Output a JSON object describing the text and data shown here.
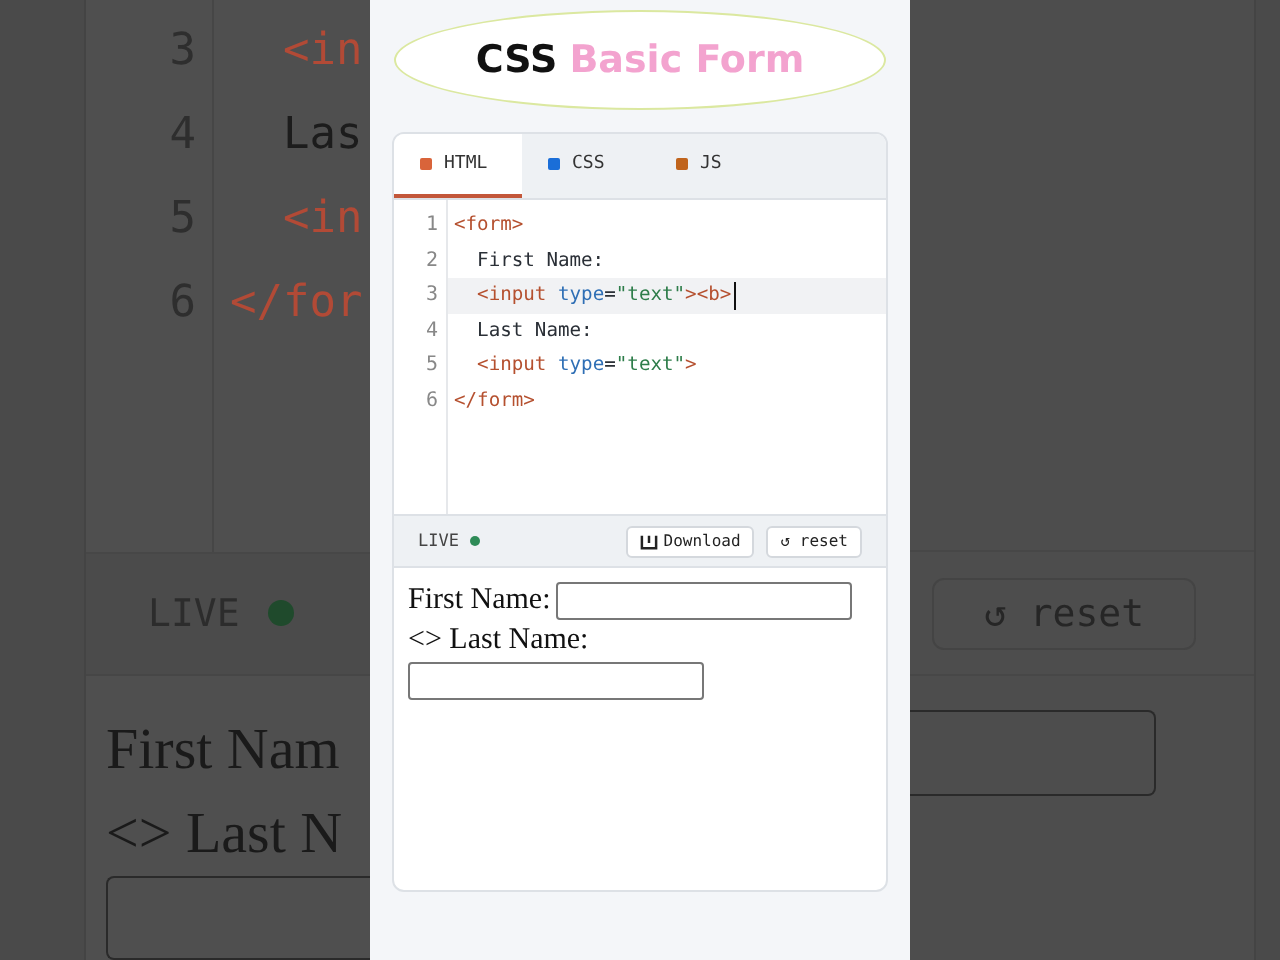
{
  "backdrop_left": {
    "code_lines": [
      {
        "number": "3",
        "tokens": [
          {
            "kind": "tag",
            "text": "  <in"
          }
        ]
      },
      {
        "number": "4",
        "tokens": [
          {
            "kind": "plain",
            "text": "  Las"
          }
        ]
      },
      {
        "number": "5",
        "tokens": [
          {
            "kind": "tag",
            "text": "  <in"
          }
        ]
      },
      {
        "number": "6",
        "tokens": [
          {
            "kind": "tag",
            "text": "</for"
          }
        ]
      }
    ],
    "live_label": "LIVE",
    "live_on": true,
    "preview": [
      {
        "kind": "text",
        "text": "First Nam"
      },
      {
        "kind": "text",
        "text": "<> Last N"
      },
      {
        "kind": "input"
      }
    ]
  },
  "backdrop_right": {
    "reset_label": "↺ reset",
    "preview": [
      {
        "kind": "input"
      }
    ]
  },
  "header": {
    "title_first": "CSS",
    "title_second": "Basic Form"
  },
  "editor": {
    "tabs": [
      {
        "label": "HTML",
        "color": "#d9643a",
        "selected": true
      },
      {
        "label": "CSS",
        "color": "#1a6ed8",
        "selected": false
      },
      {
        "label": "JS",
        "color": "#c0641c",
        "selected": false
      }
    ],
    "lines": [
      {
        "number": "1",
        "active": false,
        "cursor": false,
        "tokens": [
          {
            "kind": "tag",
            "text": "<form>"
          }
        ]
      },
      {
        "number": "2",
        "active": false,
        "cursor": false,
        "tokens": [
          {
            "kind": "plain",
            "text": "  First Name:"
          }
        ]
      },
      {
        "number": "3",
        "active": true,
        "cursor": true,
        "tokens": [
          {
            "kind": "tag",
            "text": "  <input"
          },
          {
            "kind": "attr",
            "text": " type"
          },
          {
            "kind": "plain",
            "text": "="
          },
          {
            "kind": "str",
            "text": "\"text\""
          },
          {
            "kind": "tag",
            "text": "><b>"
          }
        ]
      },
      {
        "number": "4",
        "active": false,
        "cursor": false,
        "tokens": [
          {
            "kind": "plain",
            "text": "  Last Name:"
          }
        ]
      },
      {
        "number": "5",
        "active": false,
        "cursor": false,
        "tokens": [
          {
            "kind": "tag",
            "text": "  <input"
          },
          {
            "kind": "attr",
            "text": " type"
          },
          {
            "kind": "plain",
            "text": "="
          },
          {
            "kind": "str",
            "text": "\"text\""
          },
          {
            "kind": "tag",
            "text": ">"
          }
        ]
      },
      {
        "number": "6",
        "active": false,
        "cursor": false,
        "tokens": [
          {
            "kind": "tag",
            "text": "</form>"
          }
        ]
      }
    ],
    "live_label": "LIVE",
    "live_on": true,
    "download_label": "Download",
    "reset_label": "↺ reset",
    "preview": [
      {
        "kind": "text",
        "text": "First Name:"
      },
      {
        "kind": "input"
      },
      {
        "kind": "break"
      },
      {
        "kind": "text",
        "text": "<> Last Name:"
      },
      {
        "kind": "break"
      },
      {
        "kind": "input"
      }
    ]
  }
}
